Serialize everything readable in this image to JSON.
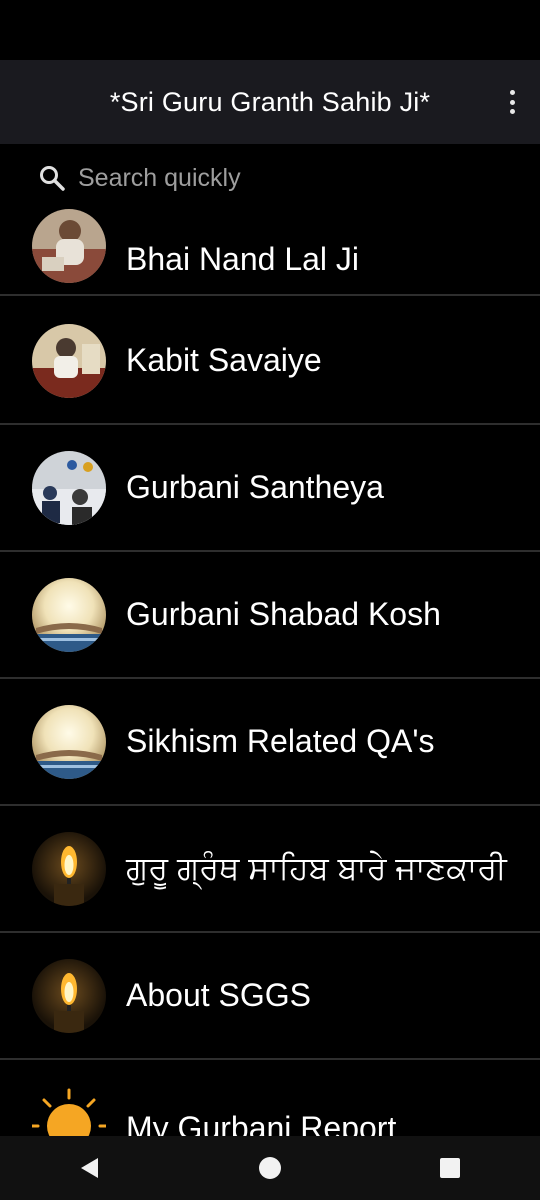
{
  "app": {
    "title": "*Sri Guru Granth Sahib Ji*"
  },
  "search": {
    "placeholder": "Search quickly"
  },
  "list": {
    "items": [
      {
        "label": "Bhai Nand Lal Ji",
        "icon": "portrait-thumbnail"
      },
      {
        "label": "Kabit Savaiye",
        "icon": "portrait-thumbnail"
      },
      {
        "label": "Gurbani Santheya",
        "icon": "class-thumbnail"
      },
      {
        "label": "Gurbani Shabad Kosh",
        "icon": "glowing-book-thumbnail"
      },
      {
        "label": "Sikhism Related QA's",
        "icon": "glowing-book-thumbnail"
      },
      {
        "label": "ਗੁਰੂ ਗ੍ਰੰਥ ਸਾਹਿਬ ਬਾਰੇ ਜਾਣਕਾਰੀ",
        "icon": "candle-thumbnail"
      },
      {
        "label": "About SGGS",
        "icon": "candle-thumbnail"
      },
      {
        "label": "My Gurbani Report",
        "icon": "sun-icon"
      }
    ]
  },
  "colors": {
    "background": "#000000",
    "app_bar": "#1a1a1f",
    "divider": "#2e2e2e",
    "nav_bar": "#111111"
  }
}
